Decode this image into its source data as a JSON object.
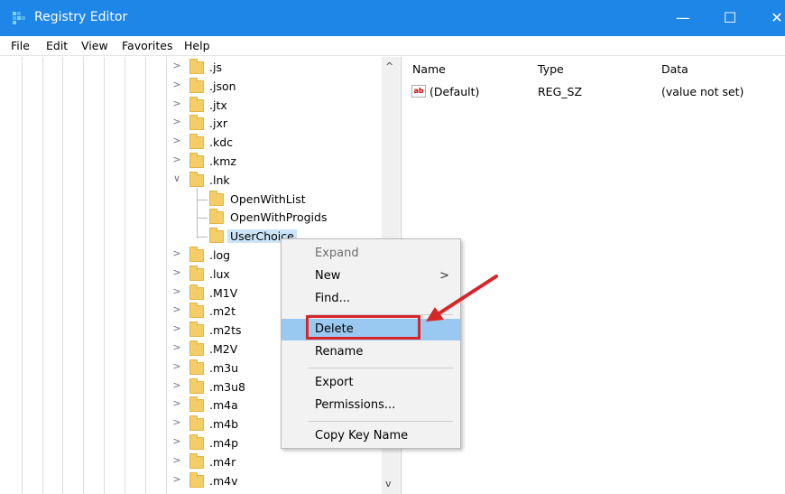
{
  "window": {
    "title": "Registry Editor",
    "minimize_glyph": "—",
    "maximize_glyph": "☐",
    "close_glyph": "✕"
  },
  "menu": [
    "File",
    "Edit",
    "View",
    "Favorites",
    "Help"
  ],
  "tree": {
    "items": [
      {
        "label": ".js",
        "expander": ">",
        "level": 0
      },
      {
        "label": ".json",
        "expander": ">",
        "level": 0
      },
      {
        "label": ".jtx",
        "expander": ">",
        "level": 0
      },
      {
        "label": ".jxr",
        "expander": ">",
        "level": 0
      },
      {
        "label": ".kdc",
        "expander": ">",
        "level": 0
      },
      {
        "label": ".kmz",
        "expander": ">",
        "level": 0
      },
      {
        "label": ".lnk",
        "expander": "∨",
        "level": 0
      },
      {
        "label": "OpenWithList",
        "expander": "",
        "level": 1
      },
      {
        "label": "OpenWithProgids",
        "expander": "",
        "level": 1
      },
      {
        "label": "UserChoice",
        "expander": "",
        "level": 1,
        "selected": true
      },
      {
        "label": ".log",
        "expander": ">",
        "level": 0
      },
      {
        "label": ".lux",
        "expander": ">",
        "level": 0
      },
      {
        "label": ".M1V",
        "expander": ">",
        "level": 0
      },
      {
        "label": ".m2t",
        "expander": ">",
        "level": 0
      },
      {
        "label": ".m2ts",
        "expander": ">",
        "level": 0
      },
      {
        "label": ".M2V",
        "expander": ">",
        "level": 0
      },
      {
        "label": ".m3u",
        "expander": ">",
        "level": 0
      },
      {
        "label": ".m3u8",
        "expander": ">",
        "level": 0
      },
      {
        "label": ".m4a",
        "expander": ">",
        "level": 0
      },
      {
        "label": ".m4b",
        "expander": ">",
        "level": 0
      },
      {
        "label": ".m4p",
        "expander": ">",
        "level": 0
      },
      {
        "label": ".m4r",
        "expander": ">",
        "level": 0
      },
      {
        "label": ".m4v",
        "expander": ">",
        "level": 0
      }
    ],
    "scroll_up": "^",
    "scroll_down": "v"
  },
  "list": {
    "headers": {
      "name": "Name",
      "type": "Type",
      "data": "Data"
    },
    "rows": [
      {
        "icon": "ab",
        "name": "(Default)",
        "type": "REG_SZ",
        "data": "(value not set)"
      }
    ]
  },
  "context_menu": {
    "items": [
      {
        "label": "Expand",
        "disabled": true
      },
      {
        "label": "New",
        "submenu": ">"
      },
      {
        "label": "Find..."
      },
      {
        "separator": true
      },
      {
        "label": "Delete",
        "highlighted": true
      },
      {
        "label": "Rename"
      },
      {
        "separator": true
      },
      {
        "label": "Export"
      },
      {
        "label": "Permissions..."
      },
      {
        "separator": true
      },
      {
        "label": "Copy Key Name"
      }
    ]
  },
  "colors": {
    "titlebar": "#1e86e6",
    "highlight": "#99c9f0",
    "annotation": "#d7262a",
    "folder": "#f3cd67"
  }
}
